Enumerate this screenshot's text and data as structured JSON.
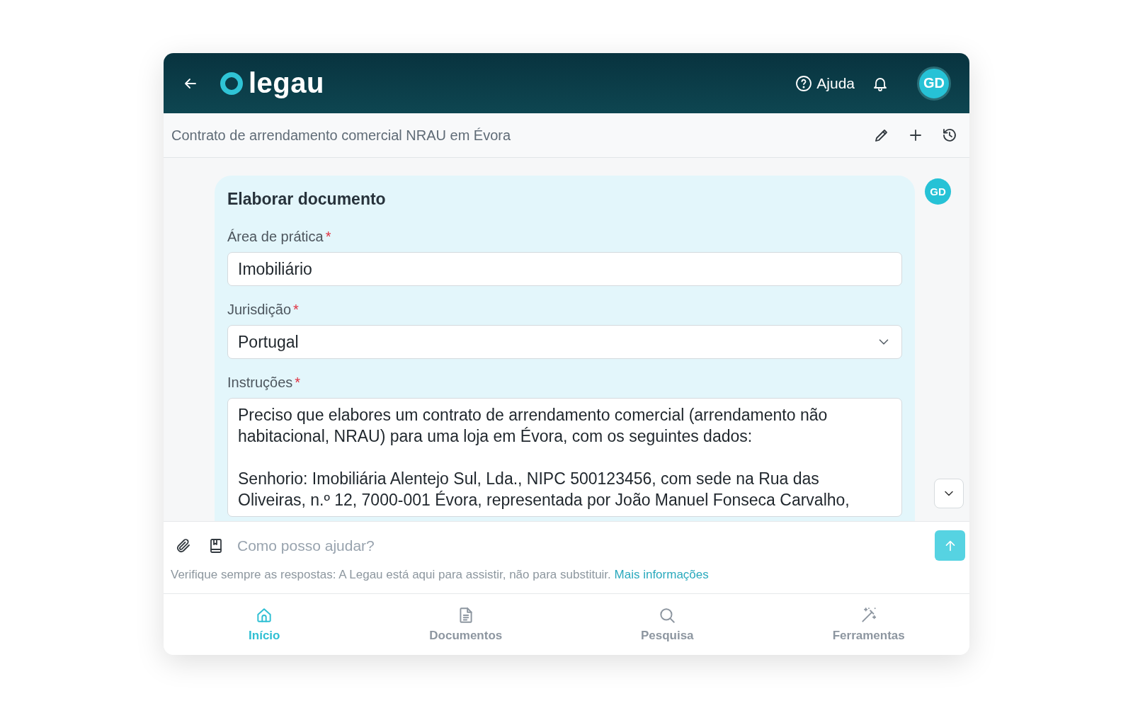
{
  "header": {
    "logo": "legau",
    "help": "Ajuda",
    "avatar": "GD"
  },
  "conversation": {
    "title": "Contrato de arrendamento comercial NRAU em Évora"
  },
  "message": {
    "avatar": "GD",
    "title": "Elaborar documento",
    "fields": [
      {
        "kind": "text",
        "label": "Área de prática",
        "required_mark": "*",
        "value": "Imobiliário"
      },
      {
        "kind": "select",
        "label": "Jurisdição",
        "required_mark": "*",
        "value": "Portugal"
      },
      {
        "kind": "textarea",
        "label": "Instruções",
        "required_mark": "*",
        "value": "Preciso que elabores um contrato de arrendamento comercial (arrendamento não habitacional, NRAU) para uma loja em Évora, com os seguintes dados:\n\nSenhorio: Imobiliária Alentejo Sul, Lda., NIPC 500123456, com sede na Rua das Oliveiras, n.º 12, 7000-001 Évora, representada por João Manuel Fonseca Carvalho,"
      }
    ]
  },
  "composer": {
    "placeholder": "Como posso ajudar?",
    "disclaimer": "Verifique sempre as respostas: A Legau está aqui para assistir, não para substituir.",
    "link": "Mais informações"
  },
  "nav": [
    {
      "kind": "home",
      "label": "Início",
      "selected": true
    },
    {
      "kind": "documents",
      "label": "Documentos",
      "selected": false
    },
    {
      "kind": "search",
      "label": "Pesquisa",
      "selected": false
    },
    {
      "kind": "tools",
      "label": "Ferramentas",
      "selected": false
    }
  ]
}
